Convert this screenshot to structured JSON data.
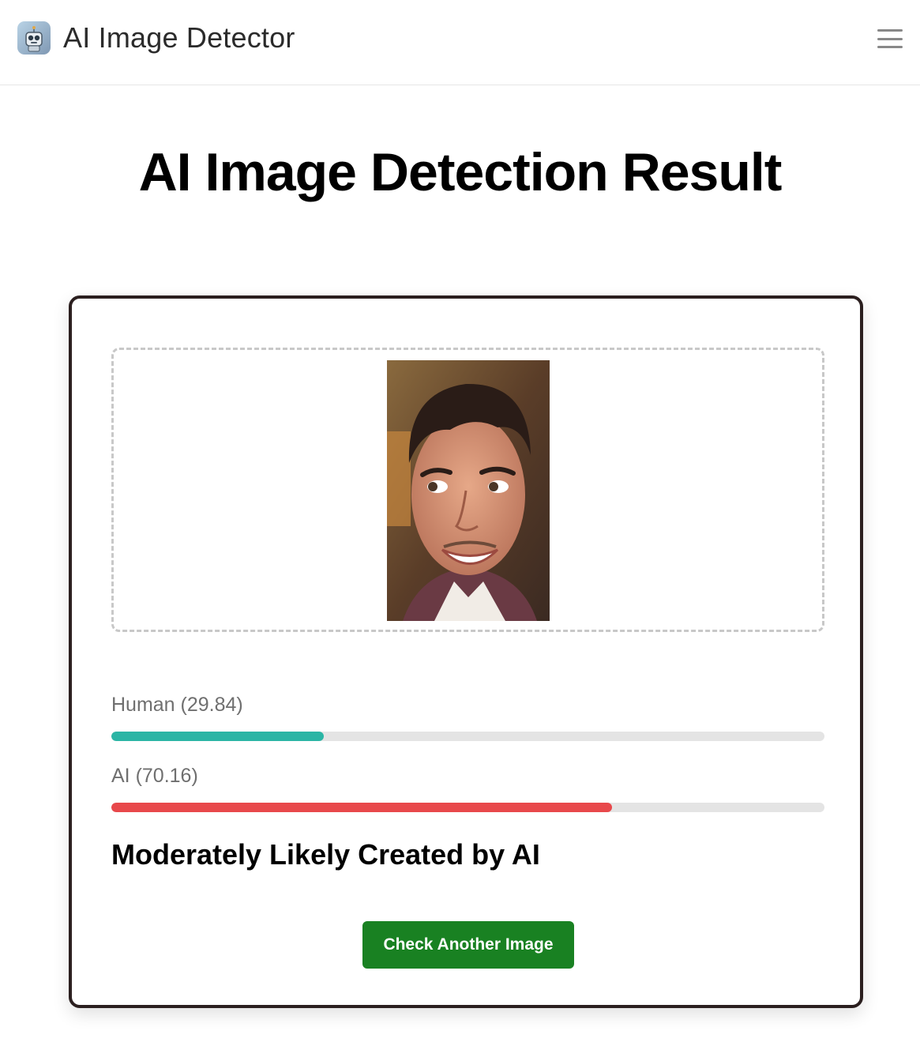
{
  "header": {
    "app_name": "AI Image Detector",
    "logo_icon": "robot-icon",
    "menu_icon": "hamburger-menu-icon"
  },
  "page": {
    "title": "AI Image Detection Result"
  },
  "result": {
    "image_description": "photo-of-smiling-man",
    "scores": [
      {
        "label": "Human",
        "value_text": "(29.84)",
        "percent": 29.84,
        "color": "#2bb5a5"
      },
      {
        "label": "AI",
        "value_text": "(70.16)",
        "percent": 70.16,
        "color": "#e8484b"
      }
    ],
    "verdict": "Moderately Likely Created by AI",
    "button_label": "Check Another Image",
    "button_color": "#198122"
  }
}
